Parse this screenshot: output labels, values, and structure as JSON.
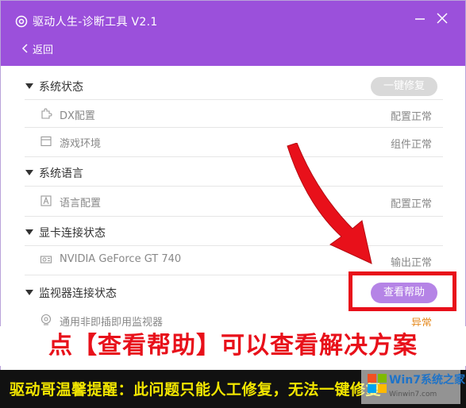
{
  "window": {
    "title": "驱动人生-诊断工具 V2.1",
    "back_label": "返回"
  },
  "sections": [
    {
      "title": "系统状态",
      "action_label": "一键修复",
      "rows": [
        {
          "label": "DX配置",
          "status": "配置正常",
          "icon": "puzzle-icon"
        },
        {
          "label": "游戏环境",
          "status": "组件正常",
          "icon": "window-icon"
        }
      ]
    },
    {
      "title": "系统语言",
      "rows": [
        {
          "label": "语言配置",
          "status": "配置正常",
          "icon": "letter-a-icon"
        }
      ]
    },
    {
      "title": "显卡连接状态",
      "rows": [
        {
          "label": "NVIDIA GeForce GT 740",
          "status": "输出正常",
          "icon": "graphics-card-icon"
        }
      ]
    },
    {
      "title": "监视器连接状态",
      "action_label": "查看帮助",
      "rows": [
        {
          "label": "通用非即插即用监视器",
          "status": "异常",
          "icon": "monitor-icon"
        }
      ]
    }
  ],
  "annotation": {
    "headline": "点【查看帮助】可以查看解决方案",
    "tip": "驱动哥温馨提醒：此问题只能人工修复，无法一键修复"
  },
  "watermark": {
    "brand": "Win7系统之家",
    "url": "Winwin7.com"
  },
  "colors": {
    "titlebar": "#9b50db",
    "help_button": "#b584e6",
    "disabled_button": "#d9d9d9",
    "error_status": "#e58a1f",
    "annotation_red": "#e8101a",
    "tip_yellow": "#f2e600"
  }
}
